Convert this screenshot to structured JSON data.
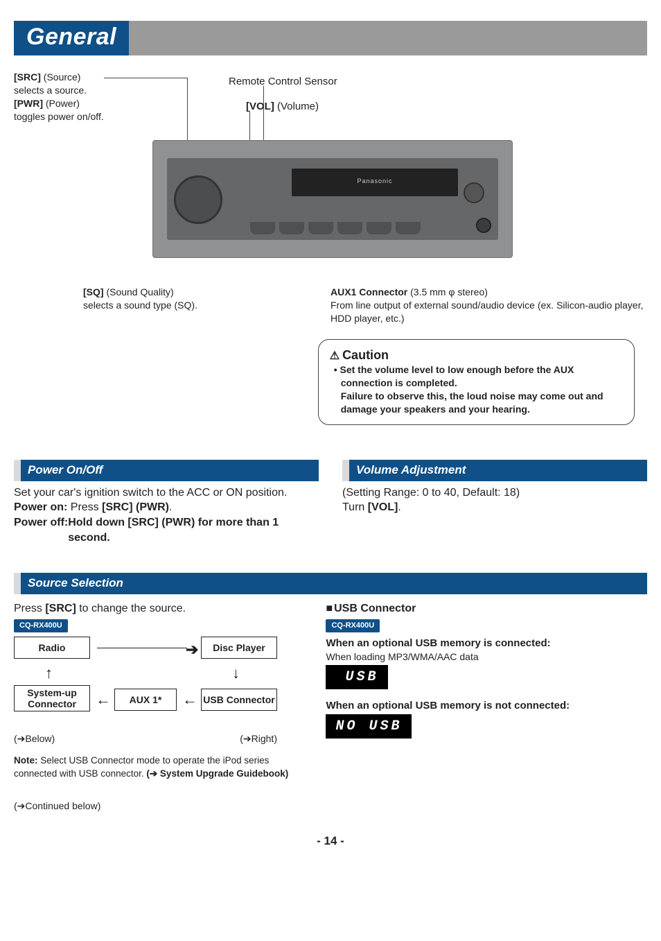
{
  "page": {
    "title": "General",
    "number": "- 14 -"
  },
  "callouts": {
    "src": {
      "tag": "[SRC]",
      "desc1": " (Source)",
      "desc2": "selects a source."
    },
    "pwr": {
      "tag": "[PWR]",
      "desc1": " (Power)",
      "desc2": "toggles power on/off."
    },
    "remote": "Remote Control Sensor",
    "vol": {
      "tag": "[VOL]",
      "desc1": " (Volume)"
    },
    "sq": {
      "tag": "[SQ]",
      "desc1": " (Sound Quality)",
      "desc2": "selects a sound type (SQ)."
    },
    "aux": {
      "tag": "AUX1 Connector",
      "desc1": " (3.5 mm φ stereo)",
      "desc2": "From line output of external sound/audio device (ex. Silicon-audio player, HDD player, etc.)"
    },
    "radio_brand": "Panasonic"
  },
  "caution": {
    "head": "Caution",
    "bullet": "• Set the volume level to low enough before the AUX connection is completed.",
    "sub": "Failure to observe this, the loud noise may come out and damage your speakers and your hearing."
  },
  "power": {
    "head": "Power On/Off",
    "line1": "Set your car's ignition switch to the ACC or ON position.",
    "on_label": "Power on: ",
    "on_action_a": "Press ",
    "on_action_b": "[SRC] (PWR)",
    "on_action_c": ".",
    "off_label": "Power off: ",
    "off_action": "Hold down [SRC] (PWR) for more than 1 second."
  },
  "volume": {
    "head": "Volume Adjustment",
    "range": "(Setting Range: 0 to 40, Default: 18)",
    "turn_a": "Turn ",
    "turn_b": "[VOL]",
    "turn_c": "."
  },
  "source": {
    "head": "Source Selection",
    "press_a": "Press ",
    "press_b": "[SRC]",
    "press_c": " to change the source.",
    "model": "CQ-RX400U",
    "boxes": {
      "radio": "Radio",
      "disc": "Disc Player",
      "sysup": "System-up Connector",
      "aux1": "AUX 1*",
      "usb": "USB Connector"
    },
    "below": "(➔Below)",
    "right": "(➔Right)",
    "note_label": "Note: ",
    "note_body_a": "Select USB Connector mode to operate the iPod series connected with USB connector. ",
    "note_body_b": "(➔ System Upgrade Guidebook)",
    "continued": "(➔Continued below)"
  },
  "usb": {
    "head": "USB Connector",
    "model": "CQ-RX400U",
    "connected_label": "When an optional USB memory is connected:",
    "connected_sub": "When loading MP3/WMA/AAC data",
    "lcd_connected": "USB",
    "notconnected_label": "When an optional USB memory is not connected:",
    "lcd_notconnected": "NO  USB"
  }
}
